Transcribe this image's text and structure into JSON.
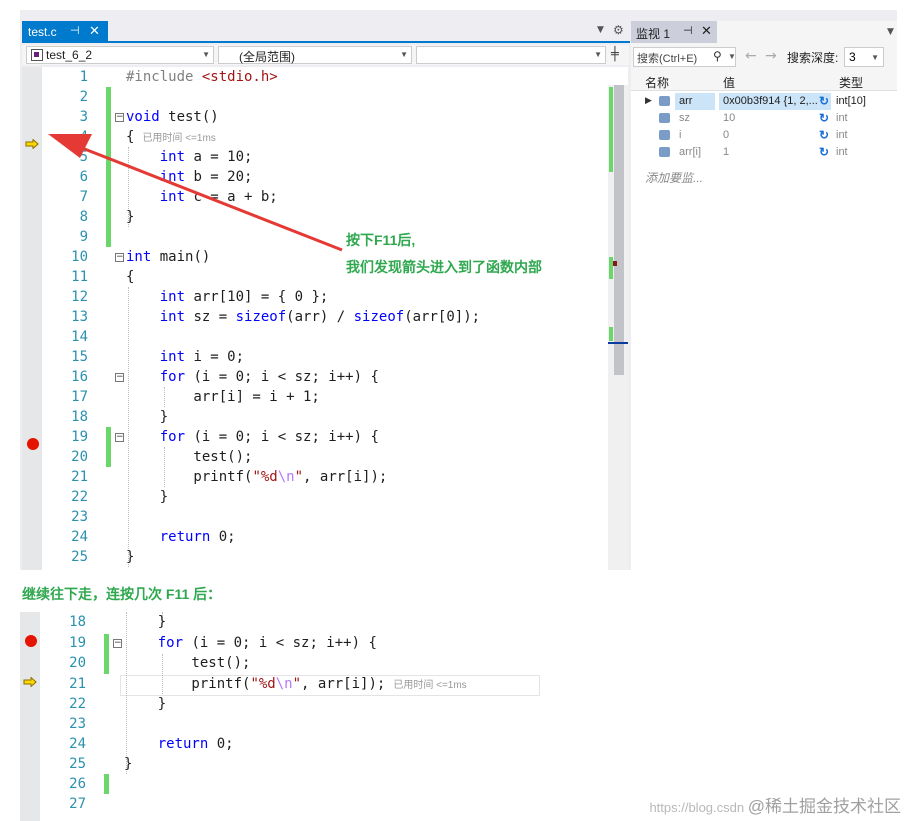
{
  "editor": {
    "tab_title": "test.c",
    "tab_pin": "⊣",
    "tab_close": "✕",
    "project_combo": "test_6_2",
    "scope_combo": "(全局范围)",
    "member_combo": "",
    "lines": [
      {
        "n": "1",
        "text": "#include <stdio.h>"
      },
      {
        "n": "2",
        "text": ""
      },
      {
        "n": "3",
        "text": "void test()"
      },
      {
        "n": "4",
        "text": "{"
      },
      {
        "n": "5",
        "text": "    int a = 10;"
      },
      {
        "n": "6",
        "text": "    int b = 20;"
      },
      {
        "n": "7",
        "text": "    int c = a + b;"
      },
      {
        "n": "8",
        "text": "}"
      },
      {
        "n": "9",
        "text": ""
      },
      {
        "n": "10",
        "text": "int main()"
      },
      {
        "n": "11",
        "text": "{"
      },
      {
        "n": "12",
        "text": "    int arr[10] = { 0 };"
      },
      {
        "n": "13",
        "text": "    int sz = sizeof(arr) / sizeof(arr[0]);"
      },
      {
        "n": "14",
        "text": ""
      },
      {
        "n": "15",
        "text": "    int i = 0;"
      },
      {
        "n": "16",
        "text": "    for (i = 0; i < sz; i++) {"
      },
      {
        "n": "17",
        "text": "        arr[i] = i + 1;"
      },
      {
        "n": "18",
        "text": "    }"
      },
      {
        "n": "19",
        "text": "    for (i = 0; i < sz; i++) {"
      },
      {
        "n": "20",
        "text": "        test();"
      },
      {
        "n": "21",
        "text": "        printf(\"%d\\n\", arr[i]);"
      },
      {
        "n": "22",
        "text": "    }"
      },
      {
        "n": "23",
        "text": ""
      },
      {
        "n": "24",
        "text": "    return 0;"
      },
      {
        "n": "25",
        "text": "}"
      }
    ],
    "elapsed_hint": "已用时间 <=1ms"
  },
  "watch": {
    "tab_title": "监视 1",
    "search_placeholder": "搜索(Ctrl+E)",
    "depth_label": "搜索深度:",
    "depth_value": "3",
    "col_name": "名称",
    "col_value": "值",
    "col_type": "类型",
    "rows": [
      {
        "name": "arr",
        "value": "0x00b3f914 {1, 2,...",
        "type": "int[10]"
      },
      {
        "name": "sz",
        "value": "10",
        "type": "int"
      },
      {
        "name": "i",
        "value": "0",
        "type": "int"
      },
      {
        "name": "arr[i]",
        "value": "1",
        "type": "int"
      }
    ],
    "add_item": "添加要监..."
  },
  "annotations": {
    "callout_line1": "按下F11后,",
    "callout_line2": "我们发现箭头进入到了函数内部",
    "caption": "继续往下走，连按几次 F11 后："
  },
  "snippet": {
    "lines": [
      {
        "n": "18",
        "text": "    }"
      },
      {
        "n": "19",
        "text": "    for (i = 0; i < sz; i++) {"
      },
      {
        "n": "20",
        "text": "        test();"
      },
      {
        "n": "21",
        "text": "        printf(\"%d\\n\", arr[i]);"
      },
      {
        "n": "22",
        "text": "    }"
      },
      {
        "n": "23",
        "text": ""
      },
      {
        "n": "24",
        "text": "    return 0;"
      },
      {
        "n": "25",
        "text": "}"
      },
      {
        "n": "26",
        "text": ""
      },
      {
        "n": "27",
        "text": ""
      }
    ],
    "elapsed_hint": "已用时间 <=1ms"
  },
  "watermark": {
    "url": "https://blog.csdn",
    "brand": "@稀土掘金技术社区"
  },
  "colors": {
    "accent": "#007acc",
    "keyword": "#0000ff",
    "string": "#a31515",
    "line_number": "#2b91af",
    "breakpoint": "#e51400",
    "annotation": "#2fa84f",
    "arrow": "#e53935"
  }
}
